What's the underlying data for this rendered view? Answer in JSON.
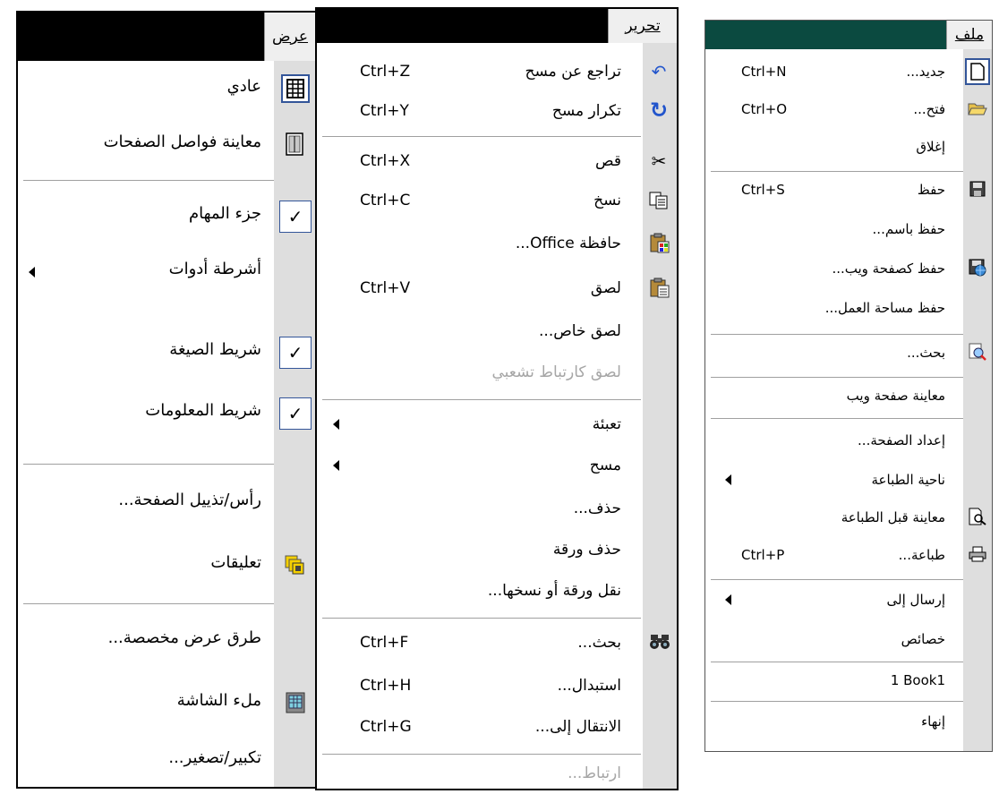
{
  "view_menu": {
    "title": "عرض",
    "items": [
      {
        "label": "عادي"
      },
      {
        "label": "معاينة فواصل الصفحات"
      },
      {
        "label": "جزء المهام"
      },
      {
        "label": "أشرطة أدوات"
      },
      {
        "label": "شريط الصيغة"
      },
      {
        "label": "شريط المعلومات"
      },
      {
        "label": "رأس/تذييل الصفحة..."
      },
      {
        "label": "تعليقات"
      },
      {
        "label": "طرق عرض مخصصة..."
      },
      {
        "label": "ملء الشاشة"
      },
      {
        "label": "تكبير/تصغير..."
      }
    ]
  },
  "edit_menu": {
    "title": "تحرير",
    "items": [
      {
        "label": "تراجع عن مسح",
        "shortcut": "Ctrl+Z"
      },
      {
        "label": "تكرار مسح",
        "shortcut": "Ctrl+Y"
      },
      {
        "label": "قص",
        "shortcut": "Ctrl+X"
      },
      {
        "label": "نسخ",
        "shortcut": "Ctrl+C"
      },
      {
        "label": "حافظة Office..."
      },
      {
        "label": "لصق",
        "shortcut": "Ctrl+V"
      },
      {
        "label": "لصق خاص..."
      },
      {
        "label": "لصق كارتباط تشعبي"
      },
      {
        "label": "تعبئة"
      },
      {
        "label": "مسح"
      },
      {
        "label": "حذف..."
      },
      {
        "label": "حذف ورقة"
      },
      {
        "label": "نقل ورقة أو نسخها..."
      },
      {
        "label": "بحث...",
        "shortcut": "Ctrl+F"
      },
      {
        "label": "استبدال...",
        "shortcut": "Ctrl+H"
      },
      {
        "label": "الانتقال إلى...",
        "shortcut": "Ctrl+G"
      },
      {
        "label": "ارتباط..."
      }
    ]
  },
  "file_menu": {
    "title": "ملف",
    "items": [
      {
        "label": "جديد...",
        "shortcut": "Ctrl+N"
      },
      {
        "label": "فتح...",
        "shortcut": "Ctrl+O"
      },
      {
        "label": "إغلاق"
      },
      {
        "label": "حفظ",
        "shortcut": "Ctrl+S"
      },
      {
        "label": "حفظ باسم..."
      },
      {
        "label": "حفظ كصفحة ويب..."
      },
      {
        "label": "حفظ مساحة العمل..."
      },
      {
        "label": "بحث..."
      },
      {
        "label": "معاينة صفحة ويب"
      },
      {
        "label": "إعداد الصفحة..."
      },
      {
        "label": "ناحية الطباعة"
      },
      {
        "label": "معاينة قبل الطباعة"
      },
      {
        "label": "طباعة...",
        "shortcut": "Ctrl+P"
      },
      {
        "label": "إرسال إلى"
      },
      {
        "label": "خصائص"
      },
      {
        "label": "1 Book1"
      },
      {
        "label": "إنهاء"
      }
    ]
  },
  "colors": {
    "menu_bar_dark": "#000000",
    "file_bar": "#0b4a40",
    "icon_strip": "#dedede",
    "check_border": "#335599"
  }
}
